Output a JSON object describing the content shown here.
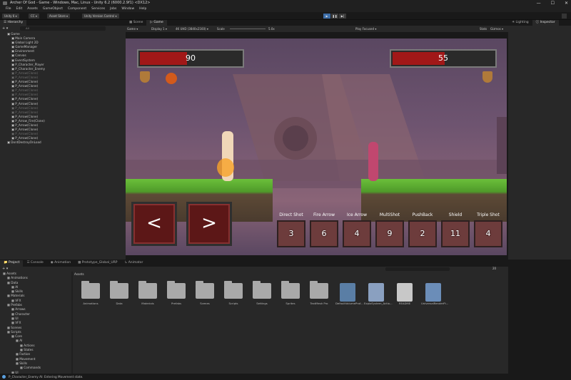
{
  "window": {
    "title": "Archer Of God - Game - Windows, Mac, Linux - Unity 6.2 (6000.2.9f1) <DX12>"
  },
  "menu": [
    "File",
    "Edit",
    "Assets",
    "GameObject",
    "Component",
    "Services",
    "Jobs",
    "Window",
    "Help"
  ],
  "toolbar": {
    "account": "Unity 6",
    "cloud_label": "CC",
    "asset_store": "Asset Store",
    "version_control": "Unity Version Control"
  },
  "hierarchy": {
    "tab": "Hierarchy",
    "search_placeholder": "All",
    "rows": [
      {
        "label": "Game",
        "dim": false,
        "indent": 1
      },
      {
        "label": "Main Camera",
        "dim": false,
        "indent": 2
      },
      {
        "label": "Global Light 2D",
        "dim": false,
        "indent": 2
      },
      {
        "label": "GameManager",
        "dim": false,
        "indent": 2
      },
      {
        "label": "Environment",
        "dim": false,
        "indent": 2
      },
      {
        "label": "Canvas",
        "dim": false,
        "indent": 2
      },
      {
        "label": "EventSystem",
        "dim": false,
        "indent": 2
      },
      {
        "label": "P_Character_Player",
        "dim": false,
        "indent": 2
      },
      {
        "label": "P_Character_Enemy",
        "dim": false,
        "indent": 2
      },
      {
        "label": "P_Arrow(Clone)",
        "dim": true,
        "indent": 2
      },
      {
        "label": "P_Arrow(Clone)",
        "dim": true,
        "indent": 2
      },
      {
        "label": "P_Arrow(Clone)",
        "dim": false,
        "indent": 2
      },
      {
        "label": "P_Arrow(Clone)",
        "dim": false,
        "indent": 2
      },
      {
        "label": "P_Arrow(Clone)",
        "dim": true,
        "indent": 2
      },
      {
        "label": "P_Arrow(Clone)",
        "dim": true,
        "indent": 2
      },
      {
        "label": "P_Arrow(Clone)",
        "dim": false,
        "indent": 2
      },
      {
        "label": "P_Arrow(Clone)",
        "dim": false,
        "indent": 2
      },
      {
        "label": "P_Arrow(Clone)",
        "dim": true,
        "indent": 2
      },
      {
        "label": "P_Arrow(Clone)",
        "dim": true,
        "indent": 2
      },
      {
        "label": "P_Arrow(Clone)",
        "dim": false,
        "indent": 2
      },
      {
        "label": "P_Arrow_Fire(Clone)",
        "dim": false,
        "indent": 2
      },
      {
        "label": "P_Arrow(Clone)",
        "dim": false,
        "indent": 2
      },
      {
        "label": "P_Arrow(Clone)",
        "dim": false,
        "indent": 2
      },
      {
        "label": "P_Arrow(Clone)",
        "dim": true,
        "indent": 2
      },
      {
        "label": "P_Arrow(Clone)",
        "dim": false,
        "indent": 2
      },
      {
        "label": "DontDestroyOnLoad",
        "dim": false,
        "indent": 1
      }
    ]
  },
  "scene_tabs": {
    "scene": "Scene",
    "game": "Game",
    "lighting": "Lighting",
    "inspector": "Inspector"
  },
  "game_toolbar": {
    "mode": "Game",
    "display": "Display 1",
    "resolution": "4K UHD (3840x2160)",
    "scale_label": "Scale",
    "scale_value": "5.0x",
    "play_focused": "Play Focused",
    "stats": "Stats",
    "gizmos": "Gizmos"
  },
  "game": {
    "player_hp": 90,
    "enemy_hp": 55,
    "player_hp_fraction": 0.45,
    "enemy_hp_fraction": 0.5,
    "left_button": "<",
    "right_button": ">",
    "skills": [
      {
        "label": "Direct Shot",
        "count": "3",
        "color": "#6d3c3c"
      },
      {
        "label": "Fire Arrow",
        "count": "6",
        "color": "#6d3c3c"
      },
      {
        "label": "Ice Arrow",
        "count": "4",
        "color": "#6d3c3c"
      },
      {
        "label": "MultiShot",
        "count": "9",
        "color": "#6d3c3c"
      },
      {
        "label": "PushBack",
        "count": "2",
        "color": "#6d3c3c"
      },
      {
        "label": "Shield",
        "count": "11",
        "color": "#6d3c3c"
      },
      {
        "label": "Triple Shot",
        "count": "4",
        "color": "#6d3c3c"
      }
    ]
  },
  "bottom": {
    "tabs": [
      "Project",
      "Console",
      "Animation",
      "Prototype_Global_URP",
      "Animator"
    ],
    "assets_header": "Assets",
    "zoom": "20",
    "tree": [
      {
        "label": "Assets",
        "indent": 0
      },
      {
        "label": "Animations",
        "indent": 1
      },
      {
        "label": "Data",
        "indent": 1
      },
      {
        "label": "AI",
        "indent": 2
      },
      {
        "label": "Skills",
        "indent": 2
      },
      {
        "label": "Materials",
        "indent": 1
      },
      {
        "label": "VFX",
        "indent": 2
      },
      {
        "label": "Prefabs",
        "indent": 1
      },
      {
        "label": "Arrows",
        "indent": 2
      },
      {
        "label": "Character",
        "indent": 2
      },
      {
        "label": "UI",
        "indent": 2
      },
      {
        "label": "VFX",
        "indent": 2
      },
      {
        "label": "Scenes",
        "indent": 1
      },
      {
        "label": "Scripts",
        "indent": 1
      },
      {
        "label": "Core",
        "indent": 2
      },
      {
        "label": "AI",
        "indent": 3
      },
      {
        "label": "Actions",
        "indent": 4
      },
      {
        "label": "States",
        "indent": 4
      },
      {
        "label": "Faction",
        "indent": 3
      },
      {
        "label": "Movement",
        "indent": 3
      },
      {
        "label": "Skills",
        "indent": 3
      },
      {
        "label": "Commands",
        "indent": 4
      },
      {
        "label": "UI",
        "indent": 2
      },
      {
        "label": "Settings",
        "indent": 1
      }
    ],
    "assets": [
      {
        "label": "Animations",
        "kind": "folder"
      },
      {
        "label": "Data",
        "kind": "folder"
      },
      {
        "label": "Materials",
        "kind": "folder"
      },
      {
        "label": "Prefabs",
        "kind": "folder"
      },
      {
        "label": "Scenes",
        "kind": "folder"
      },
      {
        "label": "Scripts",
        "kind": "folder"
      },
      {
        "label": "Settings",
        "kind": "folder"
      },
      {
        "label": "Sprites",
        "kind": "folder"
      },
      {
        "label": "TextMesh Pro",
        "kind": "folder"
      },
      {
        "label": "DefaultVolumeProf...",
        "kind": "cube"
      },
      {
        "label": "ExploSystem_Actio...",
        "kind": "map"
      },
      {
        "label": "README",
        "kind": "doc"
      },
      {
        "label": "UniversalRenderPi...",
        "kind": "gear"
      }
    ]
  },
  "status": {
    "message": "P_Character_Enemy AI: Entering Movement state."
  }
}
